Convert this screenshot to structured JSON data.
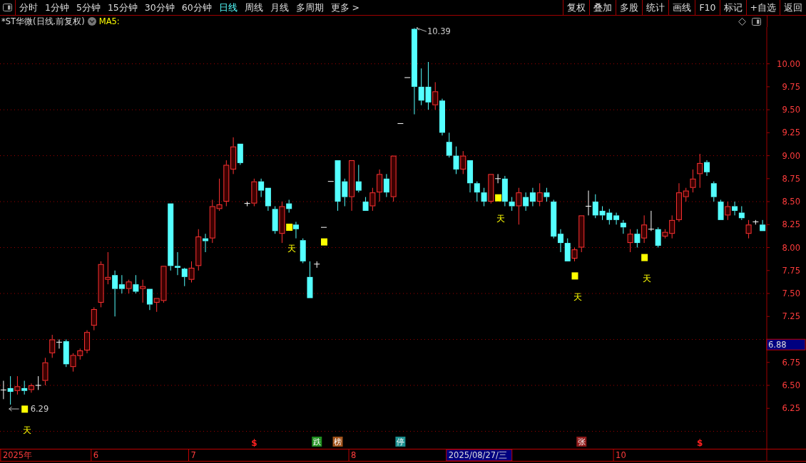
{
  "toolbar": {
    "tabs": [
      {
        "label": "分时",
        "selected": false
      },
      {
        "label": "1分钟",
        "selected": false
      },
      {
        "label": "5分钟",
        "selected": false
      },
      {
        "label": "15分钟",
        "selected": false
      },
      {
        "label": "30分钟",
        "selected": false
      },
      {
        "label": "60分钟",
        "selected": false
      },
      {
        "label": "日线",
        "selected": true
      },
      {
        "label": "周线",
        "selected": false
      },
      {
        "label": "月线",
        "selected": false
      },
      {
        "label": "多周期",
        "selected": false
      },
      {
        "label": "更多 >",
        "selected": false
      }
    ],
    "buttons": [
      "复权",
      "叠加",
      "多股",
      "统计",
      "画线",
      "F10",
      "标记",
      "+自选",
      "返回"
    ]
  },
  "chart_header": {
    "title": "*ST华微(日线.前复权)",
    "indicator": "MA5:"
  },
  "chart": {
    "chart_data": {
      "type": "candlestick",
      "grid": true,
      "ylim": [
        5.81,
        10.4
      ],
      "yticks": [
        {
          "value": 10,
          "label": "10.00"
        },
        {
          "value": 9.75,
          "label": "9.75"
        },
        {
          "value": 9.5,
          "label": "9.50"
        },
        {
          "value": 9.25,
          "label": "9.25"
        },
        {
          "value": 9,
          "label": "9.00"
        },
        {
          "value": 8.75,
          "label": "8.75"
        },
        {
          "value": 8.5,
          "label": "8.50"
        },
        {
          "value": 8.25,
          "label": "8.25"
        },
        {
          "value": 8,
          "label": "8.00"
        },
        {
          "value": 7.75,
          "label": "7.75"
        },
        {
          "value": 7.5,
          "label": "7.50"
        },
        {
          "value": 7.25,
          "label": "7.25"
        },
        {
          "value": 6.75,
          "label": "6.75"
        },
        {
          "value": 6.5,
          "label": "6.50"
        },
        {
          "value": 6.25,
          "label": "6.25"
        }
      ],
      "categories": [
        null,
        null,
        null,
        null,
        null,
        null,
        null,
        null,
        null,
        null,
        null,
        null,
        null,
        null,
        null,
        null,
        null,
        null,
        null,
        null,
        null,
        null,
        null,
        null,
        null,
        null,
        null,
        null,
        null,
        null,
        null,
        null,
        null,
        null,
        null,
        null,
        null,
        null,
        null,
        null,
        null,
        null,
        null,
        null,
        null,
        null,
        null,
        null,
        null,
        null,
        null,
        null,
        null,
        null,
        null,
        null,
        null,
        null,
        null,
        null,
        null,
        null,
        null,
        null,
        null,
        null,
        null,
        null,
        null,
        null,
        null,
        null,
        null,
        null,
        null,
        null,
        null,
        null,
        null,
        null,
        null,
        null,
        null,
        null,
        null,
        null,
        null,
        null,
        null,
        null,
        null,
        null,
        null,
        null,
        null,
        null,
        null,
        null,
        null,
        null,
        null,
        null,
        null,
        null,
        null,
        null,
        null,
        null,
        null,
        null
      ],
      "ohlc": [
        [
          6.45,
          6.55,
          6.35,
          6.45
        ],
        [
          6.47,
          6.6,
          6.29,
          6.43
        ],
        [
          6.44,
          6.6,
          6.4,
          6.49
        ],
        [
          6.47,
          6.55,
          6.4,
          6.44
        ],
        [
          6.45,
          6.52,
          6.42,
          6.5
        ],
        [
          6.5,
          6.6,
          6.45,
          6.5
        ],
        [
          6.55,
          6.8,
          6.5,
          6.75
        ],
        [
          6.85,
          7.05,
          6.8,
          7
        ],
        [
          6.97,
          7,
          6.9,
          6.97
        ],
        [
          6.98,
          7,
          6.7,
          6.73
        ],
        [
          6.7,
          6.85,
          6.65,
          6.83
        ],
        [
          6.82,
          6.9,
          6.78,
          6.88
        ],
        [
          6.88,
          7.1,
          6.85,
          7.08
        ],
        [
          7.15,
          7.35,
          7.1,
          7.33
        ],
        [
          7.4,
          7.85,
          7.35,
          7.82
        ],
        [
          7.65,
          7.95,
          7.6,
          7.68
        ],
        [
          7.7,
          7.75,
          7.25,
          7.55
        ],
        [
          7.6,
          7.7,
          7.5,
          7.55
        ],
        [
          7.55,
          7.65,
          7.5,
          7.63
        ],
        [
          7.6,
          7.7,
          7.5,
          7.52
        ],
        [
          7.55,
          7.65,
          7.4,
          7.58
        ],
        [
          7.55,
          7.55,
          7.32,
          7.38
        ],
        [
          7.4,
          7.45,
          7.3,
          7.45
        ],
        [
          7.42,
          7.8,
          7.4,
          7.8
        ],
        [
          8.48,
          8.48,
          7.75,
          7.8
        ],
        [
          7.8,
          7.95,
          7.7,
          7.78
        ],
        [
          7.77,
          7.78,
          7.58,
          7.68
        ],
        [
          7.65,
          7.85,
          7.62,
          7.78
        ],
        [
          7.8,
          8.2,
          7.75,
          8.12
        ],
        [
          8.1,
          8.15,
          7.95,
          8.07
        ],
        [
          8.1,
          8.52,
          8.05,
          8.45
        ],
        [
          8.42,
          8.75,
          8.4,
          8.47
        ],
        [
          8.5,
          8.95,
          8.45,
          8.9
        ],
        [
          8.85,
          9.2,
          8.8,
          9.1
        ],
        [
          9.13,
          9.13,
          8.9,
          8.92
        ],
        [
          8.48,
          8.5,
          8.45,
          8.48
        ],
        [
          8.48,
          8.75,
          8.45,
          8.72
        ],
        [
          8.72,
          8.75,
          8.55,
          8.62
        ],
        [
          8.65,
          8.65,
          8.4,
          8.45
        ],
        [
          8.42,
          8.45,
          8.15,
          8.18
        ],
        [
          8.15,
          8.5,
          8.05,
          8.45
        ],
        [
          8.48,
          8.52,
          8.38,
          8.42
        ],
        [
          8.25,
          8.28,
          8.1,
          8.2
        ],
        [
          8.08,
          8.1,
          7.83,
          7.85
        ],
        [
          7.68,
          7.85,
          7.45,
          7.45
        ],
        [
          7.82,
          7.85,
          7.78,
          7.82
        ],
        [
          8.22,
          8.22,
          8.22,
          8.22
        ],
        [
          8.72,
          8.72,
          8.72,
          8.72
        ],
        [
          8.95,
          8.95,
          8.4,
          8.5
        ],
        [
          8.72,
          8.75,
          8.45,
          8.55
        ],
        [
          8.55,
          8.95,
          8.4,
          8.95
        ],
        [
          8.72,
          8.9,
          8.6,
          8.62
        ],
        [
          8.5,
          8.55,
          8.4,
          8.4
        ],
        [
          8.45,
          8.65,
          8.4,
          8.6
        ],
        [
          8.6,
          8.85,
          8.5,
          8.8
        ],
        [
          8.75,
          8.8,
          8.55,
          8.6
        ],
        [
          8.55,
          9,
          8.5,
          9
        ],
        [
          9.35,
          9.35,
          9.35,
          9.35
        ],
        [
          9.85,
          9.85,
          9.85,
          9.85
        ],
        [
          10.38,
          10.39,
          9.45,
          9.75
        ],
        [
          9.75,
          9.95,
          9.55,
          9.6
        ],
        [
          9.75,
          10.02,
          9.5,
          9.58
        ],
        [
          9.55,
          9.8,
          9.5,
          9.7
        ],
        [
          9.6,
          9.62,
          9.22,
          9.25
        ],
        [
          9.15,
          9.25,
          8.98,
          9
        ],
        [
          9,
          9.1,
          8.8,
          8.85
        ],
        [
          8.85,
          9.05,
          8.8,
          9
        ],
        [
          8.95,
          8.95,
          8.6,
          8.7
        ],
        [
          8.7,
          8.72,
          8.5,
          8.6
        ],
        [
          8.6,
          8.65,
          8.45,
          8.5
        ],
        [
          8.5,
          8.8,
          8.48,
          8.8
        ],
        [
          8.75,
          8.8,
          8.7,
          8.75
        ],
        [
          8.75,
          8.78,
          8.45,
          8.5
        ],
        [
          8.5,
          8.55,
          8.4,
          8.45
        ],
        [
          8.45,
          8.65,
          8.25,
          8.6
        ],
        [
          8.55,
          8.6,
          8.4,
          8.45
        ],
        [
          8.6,
          8.65,
          8.45,
          8.5
        ],
        [
          8.5,
          8.7,
          8.45,
          8.6
        ],
        [
          8.6,
          8.65,
          8.5,
          8.55
        ],
        [
          8.5,
          8.52,
          8.1,
          8.12
        ],
        [
          8.15,
          8.2,
          7.95,
          8.05
        ],
        [
          8.05,
          8.1,
          7.85,
          7.85
        ],
        [
          7.88,
          8,
          7.85,
          7.98
        ],
        [
          8,
          8.35,
          7.95,
          8.35
        ],
        [
          8.45,
          8.62,
          8.35,
          8.45
        ],
        [
          8.5,
          8.58,
          8.32,
          8.35
        ],
        [
          8.4,
          8.45,
          8.3,
          8.35
        ],
        [
          8.38,
          8.42,
          8.25,
          8.3
        ],
        [
          8.35,
          8.38,
          8.25,
          8.3
        ],
        [
          8.27,
          8.3,
          8.15,
          8.22
        ],
        [
          8.05,
          8.2,
          7.95,
          8.15
        ],
        [
          8.15,
          8.2,
          8,
          8.05
        ],
        [
          8.1,
          8.35,
          8.05,
          8.25
        ],
        [
          8.2,
          8.4,
          8.18,
          8.2
        ],
        [
          8.2,
          8.22,
          8,
          8.02
        ],
        [
          8.12,
          8.2,
          8.1,
          8.17
        ],
        [
          8.15,
          8.35,
          8.1,
          8.3
        ],
        [
          8.3,
          8.7,
          8.28,
          8.6
        ],
        [
          8.55,
          8.65,
          8.5,
          8.62
        ],
        [
          8.65,
          8.85,
          8.6,
          8.75
        ],
        [
          8.8,
          9.02,
          8.65,
          8.92
        ],
        [
          8.93,
          8.95,
          8.78,
          8.82
        ],
        [
          8.7,
          8.72,
          8.5,
          8.55
        ],
        [
          8.5,
          8.52,
          8.3,
          8.3
        ],
        [
          8.35,
          8.5,
          8.3,
          8.45
        ],
        [
          8.45,
          8.5,
          8.35,
          8.4
        ],
        [
          8.38,
          8.45,
          8.3,
          8.32
        ],
        [
          8.15,
          8.3,
          8.1,
          8.25
        ],
        [
          8.28,
          8.3,
          8.25,
          8.28
        ],
        [
          8.25,
          8.3,
          8.18,
          8.18
        ]
      ],
      "annotations": [
        "10.39",
        "6.29"
      ]
    },
    "date_axis": [
      "2025年",
      "6",
      "7",
      "8",
      "10"
    ],
    "signals": [
      {
        "kind": "block_label",
        "text": "天"
      },
      {
        "kind": "block_label",
        "text": "天"
      },
      {
        "kind": "block"
      },
      {
        "kind": "block_label",
        "text": "天"
      },
      {
        "kind": "block_label",
        "text": "天"
      },
      {
        "kind": "block_label",
        "text": "天"
      }
    ],
    "events": [
      {
        "kind": "symbol",
        "text": "$",
        "color": "#ff2020"
      },
      {
        "kind": "tag",
        "text": "跌",
        "color": "#1f8f1f"
      },
      {
        "kind": "tag",
        "text": "榜",
        "color": "#a0521a"
      },
      {
        "kind": "tag",
        "text": "停",
        "color": "#1a8f8f"
      },
      {
        "kind": "tag",
        "text": "张",
        "color": "#8f1a1a"
      },
      {
        "kind": "symbol",
        "text": "$",
        "color": "#ff2020"
      }
    ],
    "cursor_date": "2025/08/27/三",
    "price_tag": "6.88"
  }
}
